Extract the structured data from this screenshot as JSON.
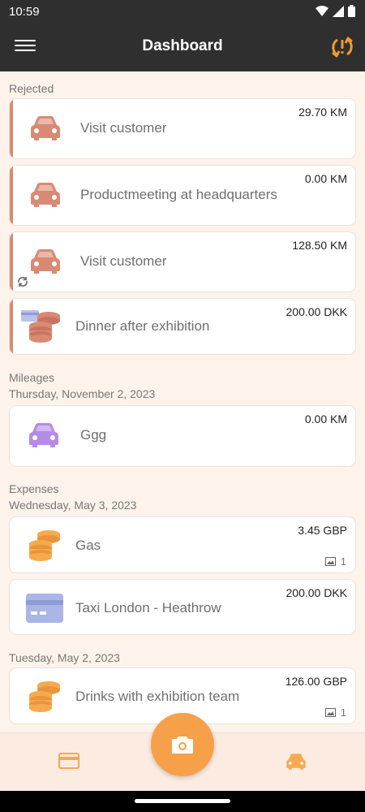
{
  "status_bar": {
    "time": "10:59"
  },
  "app_bar": {
    "title": "Dashboard"
  },
  "sections": {
    "rejected": "Rejected",
    "mileages": "Mileages",
    "mileages_date": "Thursday, November 2, 2023",
    "expenses": "Expenses",
    "expenses_date_1": "Wednesday, May 3, 2023",
    "expenses_date_2": "Tuesday, May 2, 2023"
  },
  "rejected_items": [
    {
      "title": "Visit customer",
      "amount": "29.70 KM",
      "icon": "car-icon"
    },
    {
      "title": "Productmeeting at headquarters",
      "amount": "0.00 KM",
      "icon": "car-icon"
    },
    {
      "title": "Visit customer",
      "amount": "128.50 KM",
      "icon": "car-icon",
      "syncing": true
    },
    {
      "title": "Dinner after exhibition",
      "amount": "200.00 DKK",
      "icon": "cash-card-icon"
    }
  ],
  "mileage_items": [
    {
      "title": "Ggg",
      "amount": "0.00 KM",
      "icon": "car-icon"
    }
  ],
  "expense_items": [
    {
      "title": "Gas",
      "amount": "3.45 GBP",
      "icon": "coins-icon",
      "attachments": "1"
    },
    {
      "title": "Taxi London - Heathrow",
      "amount": "200.00 DKK",
      "icon": "credit-card-icon"
    },
    {
      "title": "Drinks with exhibition team",
      "amount": "126.00 GBP",
      "icon": "coins-icon",
      "attachments": "1"
    }
  ],
  "colors": {
    "rejected_accent": "#d98a74",
    "mileage_accent": "#b48ce6",
    "expense_accent": "#f6a94f",
    "card_accent": "#a9b6e6",
    "fab": "#f7a04a"
  }
}
